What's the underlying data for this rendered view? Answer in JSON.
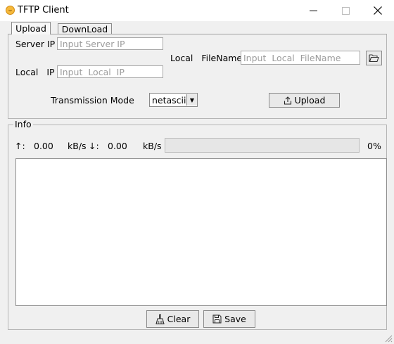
{
  "window": {
    "title": "TFTP Client",
    "controls": {
      "minimize": "—",
      "maximize": "☐",
      "close": "✕"
    }
  },
  "tabs": [
    {
      "label": "Upload",
      "active": true
    },
    {
      "label": "DownLoad",
      "active": false
    }
  ],
  "upload": {
    "server_ip_label": "Server IP",
    "server_ip_placeholder": "Input Server IP",
    "server_ip_value": "",
    "local_ip_label": "Local   IP",
    "local_ip_placeholder": "Input  Local  IP",
    "local_ip_value": "",
    "local_filename_label": "Local   FileName",
    "local_filename_placeholder": "Input  Local  FileName",
    "local_filename_value": "",
    "browse_icon": "folder-open-icon",
    "mode_label": "Transmission Mode",
    "mode_selected": "netascii",
    "upload_button_label": "Upload",
    "upload_icon": "upload-icon"
  },
  "info": {
    "group_label": "Info",
    "up_arrow": "↑:",
    "up_speed": "0.00",
    "up_unit": "kB/s",
    "down_arrow": "↓:",
    "down_speed": "0.00",
    "down_unit": "kB/s",
    "progress_fraction": 0,
    "progress_text": "0%",
    "log_text": ""
  },
  "actions": {
    "clear_label": "Clear",
    "clear_icon": "broom-icon",
    "save_label": "Save",
    "save_icon": "floppy-disk-icon"
  },
  "colors": {
    "titlebar": "#ffffff",
    "window_bg": "#f0f0f0",
    "progress_fill": "#06b025"
  }
}
